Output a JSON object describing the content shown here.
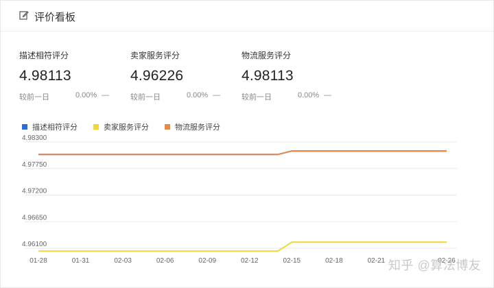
{
  "header": {
    "title": "评价看板",
    "icon": "edit-icon"
  },
  "metrics": [
    {
      "label": "描述相符评分",
      "value": "4.98113",
      "compare_label": "较前一日",
      "change": "0.00%",
      "trend": "—"
    },
    {
      "label": "卖家服务评分",
      "value": "4.96226",
      "compare_label": "较前一日",
      "change": "0.00%",
      "trend": "—"
    },
    {
      "label": "物流服务评分",
      "value": "4.98113",
      "compare_label": "较前一日",
      "change": "0.00%",
      "trend": "—"
    }
  ],
  "colors": {
    "blue": "#2f6ed8",
    "yellow": "#f0d73c",
    "orange": "#e8894a",
    "grid": "#e9e9e9",
    "axis_text": "#666666"
  },
  "chart_data": {
    "type": "line",
    "x": [
      "01-28",
      "01-29",
      "01-30",
      "01-31",
      "02-01",
      "02-02",
      "02-03",
      "02-04",
      "02-05",
      "02-06",
      "02-07",
      "02-08",
      "02-09",
      "02-10",
      "02-11",
      "02-12",
      "02-13",
      "02-14",
      "02-15",
      "02-16",
      "02-17",
      "02-18",
      "02-19",
      "02-20",
      "02-21",
      "02-22",
      "02-23",
      "02-24",
      "02-25",
      "02-26"
    ],
    "x_tick_labels": [
      "01-28",
      "01-31",
      "02-03",
      "02-06",
      "02-09",
      "02-12",
      "02-15",
      "02-18",
      "02-21",
      "02-26"
    ],
    "y_ticks": [
      "4.98300",
      "4.97750",
      "4.97200",
      "4.96650",
      "4.96100"
    ],
    "ylim": [
      4.961,
      4.983
    ],
    "grid": true,
    "legend_position": "top-left",
    "series": [
      {
        "name": "描述相符评分",
        "color": "#2f6ed8",
        "values": [
          4.9804,
          4.9804,
          4.9804,
          4.9804,
          4.9804,
          4.9804,
          4.9804,
          4.9804,
          4.9804,
          4.9804,
          4.9804,
          4.9804,
          4.9804,
          4.9804,
          4.9804,
          4.9804,
          4.9804,
          4.9804,
          4.98113,
          4.98113,
          4.98113,
          4.98113,
          4.98113,
          4.98113,
          4.98113,
          4.98113,
          4.98113,
          4.98113,
          4.98113,
          4.98113
        ]
      },
      {
        "name": "卖家服务评分",
        "color": "#f0d73c",
        "values": [
          4.9604,
          4.9604,
          4.9604,
          4.9604,
          4.9604,
          4.9604,
          4.9604,
          4.9604,
          4.9604,
          4.9604,
          4.9604,
          4.9604,
          4.9604,
          4.9604,
          4.9604,
          4.9604,
          4.9604,
          4.9604,
          4.96226,
          4.96226,
          4.96226,
          4.96226,
          4.96226,
          4.96226,
          4.96226,
          4.96226,
          4.96226,
          4.96226,
          4.96226,
          4.96226
        ]
      },
      {
        "name": "物流服务评分",
        "color": "#e8894a",
        "values": [
          4.9804,
          4.9804,
          4.9804,
          4.9804,
          4.9804,
          4.9804,
          4.9804,
          4.9804,
          4.9804,
          4.9804,
          4.9804,
          4.9804,
          4.9804,
          4.9804,
          4.9804,
          4.9804,
          4.9804,
          4.9804,
          4.98113,
          4.98113,
          4.98113,
          4.98113,
          4.98113,
          4.98113,
          4.98113,
          4.98113,
          4.98113,
          4.98113,
          4.98113,
          4.98113
        ]
      }
    ]
  },
  "watermark": "知乎 @算法博友"
}
